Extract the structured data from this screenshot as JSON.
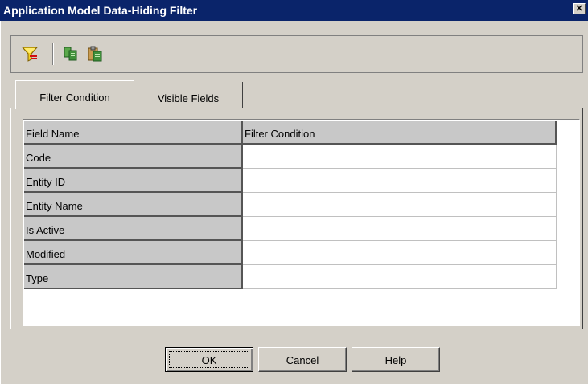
{
  "window": {
    "title": "Application Model Data-Hiding Filter",
    "close_label": "✕"
  },
  "toolbar": {
    "buttons": [
      {
        "icon": "filter-icon"
      },
      {
        "icon": "copy-icon"
      },
      {
        "icon": "paste-icon"
      }
    ]
  },
  "tabs": [
    {
      "label": "Filter Condition",
      "active": true
    },
    {
      "label": "Visible Fields",
      "active": false
    }
  ],
  "grid": {
    "columns": [
      "Field Name",
      "Filter Condition"
    ],
    "rows": [
      {
        "field": "Code",
        "condition": ""
      },
      {
        "field": "Entity ID",
        "condition": ""
      },
      {
        "field": "Entity Name",
        "condition": ""
      },
      {
        "field": "Is Active",
        "condition": ""
      },
      {
        "field": "Modified",
        "condition": ""
      },
      {
        "field": "Type",
        "condition": ""
      }
    ]
  },
  "buttons": {
    "ok": "OK",
    "cancel": "Cancel",
    "help": "Help"
  },
  "colors": {
    "titlebar": "#0a246a",
    "dialog_bg": "#d4d0c8",
    "filter_icon": "#e8b800",
    "copy_icon": "#2e8b3a"
  }
}
